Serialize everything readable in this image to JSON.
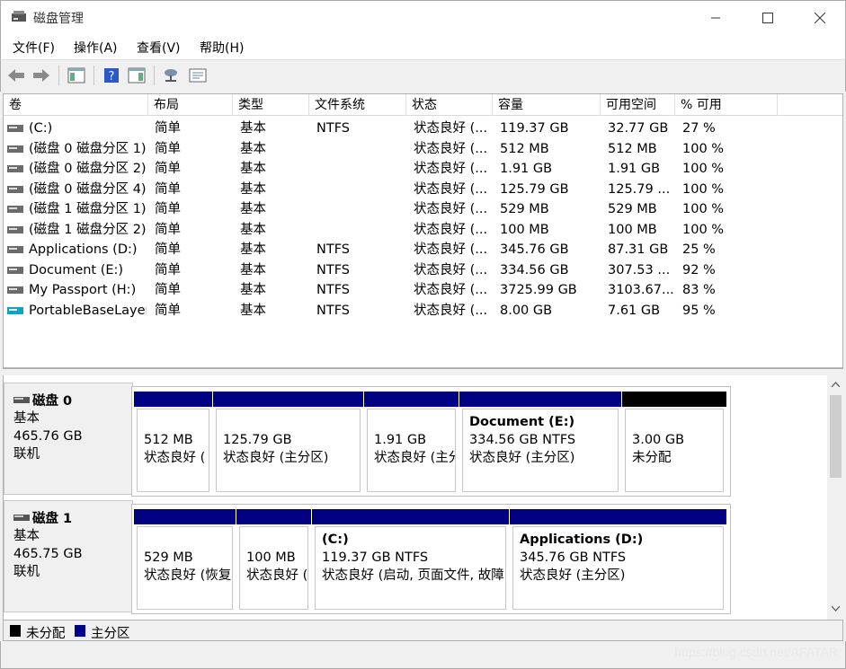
{
  "window": {
    "title": "磁盘管理",
    "minimize": "—",
    "maximize": "☐",
    "close": "✕"
  },
  "menu": [
    "文件(F)",
    "操作(A)",
    "查看(V)",
    "帮助(H)"
  ],
  "columns": [
    "卷",
    "布局",
    "类型",
    "文件系统",
    "状态",
    "容量",
    "可用空间",
    "% 可用"
  ],
  "volumes": [
    {
      "name": "(C:)",
      "layout": "简单",
      "type": "基本",
      "fs": "NTFS",
      "status": "状态良好 (...",
      "capacity": "119.37 GB",
      "free": "32.77 GB",
      "pct": "27 %",
      "icon": "drive-icon"
    },
    {
      "name": "(磁盘 0 磁盘分区 1)",
      "layout": "简单",
      "type": "基本",
      "fs": "",
      "status": "状态良好 (...",
      "capacity": "512 MB",
      "free": "512 MB",
      "pct": "100 %",
      "icon": "drive-icon"
    },
    {
      "name": "(磁盘 0 磁盘分区 2)",
      "layout": "简单",
      "type": "基本",
      "fs": "",
      "status": "状态良好 (...",
      "capacity": "1.91 GB",
      "free": "1.91 GB",
      "pct": "100 %",
      "icon": "drive-icon"
    },
    {
      "name": "(磁盘 0 磁盘分区 4)",
      "layout": "简单",
      "type": "基本",
      "fs": "",
      "status": "状态良好 (...",
      "capacity": "125.79 GB",
      "free": "125.79 ...",
      "pct": "100 %",
      "icon": "drive-icon"
    },
    {
      "name": "(磁盘 1 磁盘分区 1)",
      "layout": "简单",
      "type": "基本",
      "fs": "",
      "status": "状态良好 (...",
      "capacity": "529 MB",
      "free": "529 MB",
      "pct": "100 %",
      "icon": "drive-icon"
    },
    {
      "name": "(磁盘 1 磁盘分区 2)",
      "layout": "简单",
      "type": "基本",
      "fs": "",
      "status": "状态良好 (...",
      "capacity": "100 MB",
      "free": "100 MB",
      "pct": "100 %",
      "icon": "drive-icon"
    },
    {
      "name": "Applications (D:)",
      "layout": "简单",
      "type": "基本",
      "fs": "NTFS",
      "status": "状态良好 (...",
      "capacity": "345.76 GB",
      "free": "87.31 GB",
      "pct": "25 %",
      "icon": "drive-icon"
    },
    {
      "name": "Document (E:)",
      "layout": "简单",
      "type": "基本",
      "fs": "NTFS",
      "status": "状态良好 (...",
      "capacity": "334.56 GB",
      "free": "307.53 ...",
      "pct": "92 %",
      "icon": "drive-icon"
    },
    {
      "name": "My Passport (H:)",
      "layout": "简单",
      "type": "基本",
      "fs": "NTFS",
      "status": "状态良好 (...",
      "capacity": "3725.99 GB",
      "free": "3103.67...",
      "pct": "83 %",
      "icon": "drive-icon"
    },
    {
      "name": "PortableBaseLayer",
      "layout": "简单",
      "type": "基本",
      "fs": "NTFS",
      "status": "状态良好 (...",
      "capacity": "8.00 GB",
      "free": "7.61 GB",
      "pct": "95 %",
      "icon": "removable-drive-icon"
    }
  ],
  "disks": [
    {
      "name": "磁盘 0",
      "type": "基本",
      "size": "465.76 GB",
      "state": "联机",
      "partitions": [
        {
          "title": "",
          "size": "512 MB",
          "status": "状态良好 (",
          "kind": "primary"
        },
        {
          "title": "",
          "size": "125.79 GB",
          "status": "状态良好 (主分区)",
          "kind": "primary"
        },
        {
          "title": "",
          "size": "1.91 GB",
          "status": "状态良好 (主分",
          "kind": "primary"
        },
        {
          "title": "Document  (E:)",
          "size": "334.56 GB NTFS",
          "status": "状态良好 (主分区)",
          "kind": "primary"
        },
        {
          "title": "",
          "size": "3.00 GB",
          "status": "未分配",
          "kind": "unallocated"
        }
      ]
    },
    {
      "name": "磁盘 1",
      "type": "基本",
      "size": "465.75 GB",
      "state": "联机",
      "partitions": [
        {
          "title": "",
          "size": "529 MB",
          "status": "状态良好 (恢复",
          "kind": "primary"
        },
        {
          "title": "",
          "size": "100 MB",
          "status": "状态良好 (",
          "kind": "primary"
        },
        {
          "title": "(C:)",
          "size": "119.37 GB NTFS",
          "status": "状态良好 (启动, 页面文件, 故障",
          "kind": "primary"
        },
        {
          "title": "Applications  (D:)",
          "size": "345.76 GB NTFS",
          "status": "状态良好 (主分区)",
          "kind": "primary"
        }
      ]
    }
  ],
  "legend": [
    {
      "label": "未分配",
      "color": "#000000"
    },
    {
      "label": "主分区",
      "color": "#00008b"
    }
  ],
  "colors": {
    "primary": "#000080",
    "unallocated": "#000000"
  },
  "watermark": "https://blog.csdn.net/AFATAR"
}
